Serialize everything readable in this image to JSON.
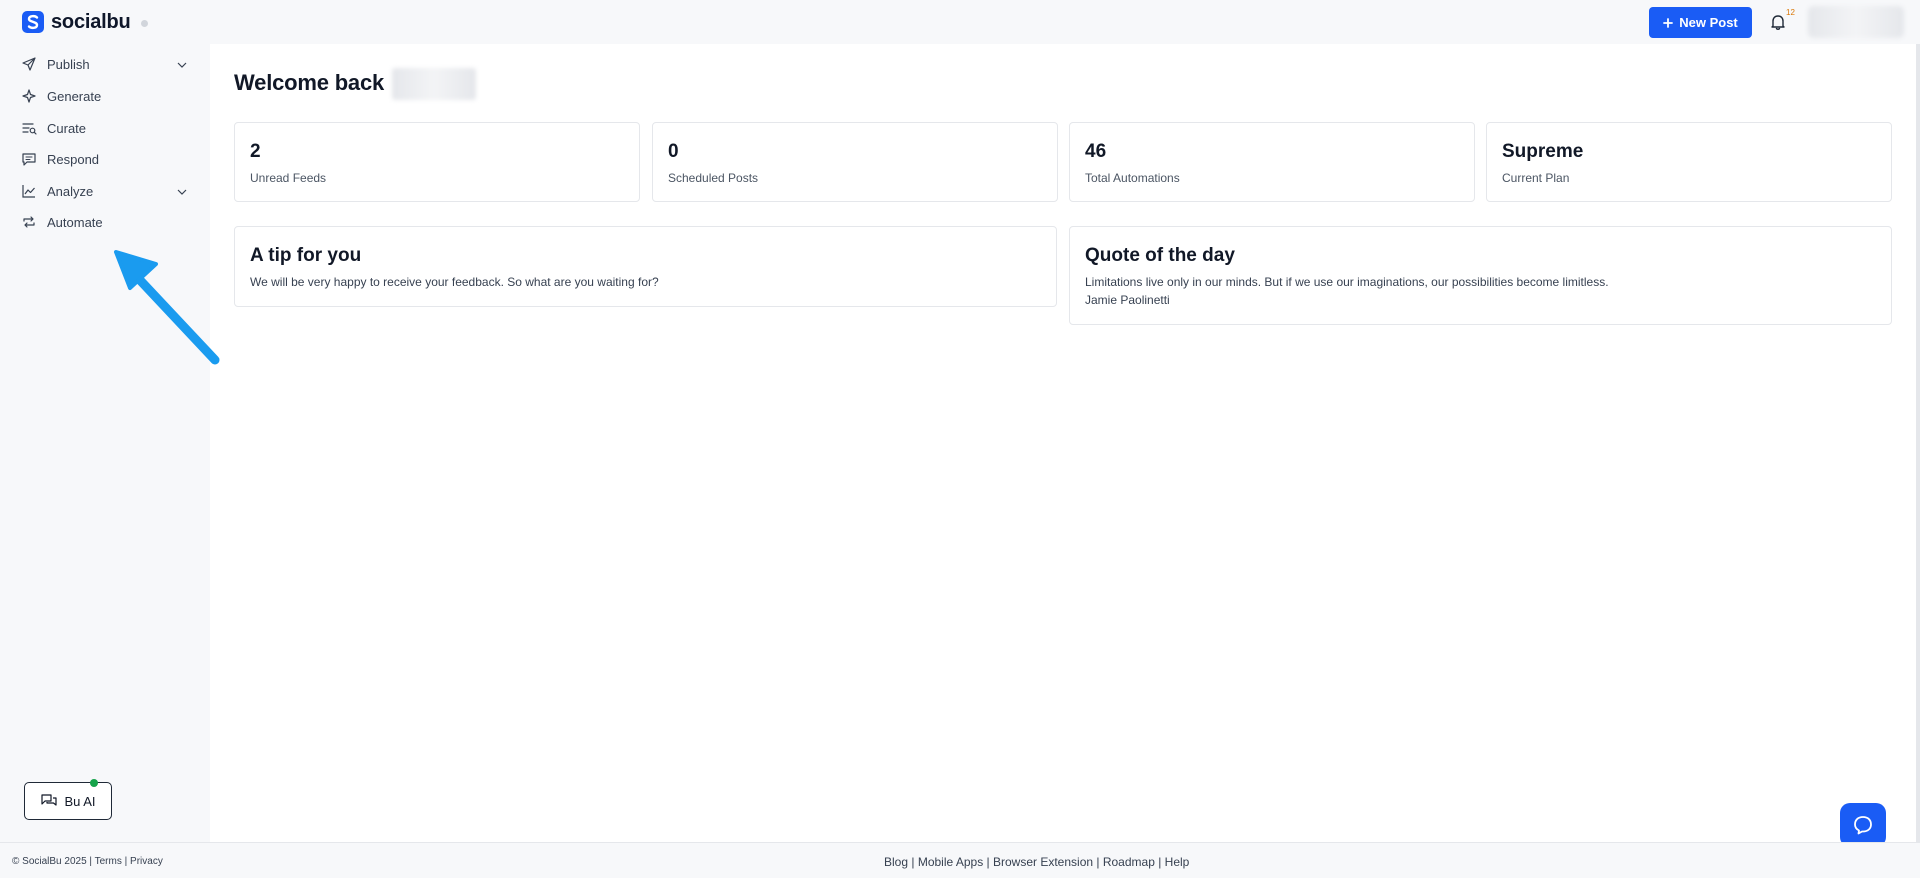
{
  "brand": {
    "name": "socialbu"
  },
  "header": {
    "new_post_label": "New Post",
    "notification_count": "12"
  },
  "sidebar": {
    "items": [
      {
        "label": "Publish",
        "icon": "send-icon",
        "has_children": true
      },
      {
        "label": "Generate",
        "icon": "sparkle-icon",
        "has_children": false
      },
      {
        "label": "Curate",
        "icon": "curate-icon",
        "has_children": false
      },
      {
        "label": "Respond",
        "icon": "message-icon",
        "has_children": false
      },
      {
        "label": "Analyze",
        "icon": "chart-line-icon",
        "has_children": true
      },
      {
        "label": "Automate",
        "icon": "repeat-icon",
        "has_children": false
      }
    ],
    "bu_ai_label": "Bu AI"
  },
  "main": {
    "welcome": "Welcome back",
    "stats": [
      {
        "value": "2",
        "label": "Unread Feeds"
      },
      {
        "value": "0",
        "label": "Scheduled Posts"
      },
      {
        "value": "46",
        "label": "Total Automations"
      },
      {
        "value": "Supreme",
        "label": "Current Plan"
      }
    ],
    "tip": {
      "title": "A tip for you",
      "text": "We will be very happy to receive your feedback. So what are you waiting for?"
    },
    "quote": {
      "title": "Quote of the day",
      "text": "Limitations live only in our minds. But if we use our imaginations, our possibilities become limitless.",
      "author": "Jamie Paolinetti"
    }
  },
  "footer": {
    "copyright": "© SocialBu 2025",
    "terms": "Terms",
    "privacy": "Privacy",
    "links": [
      "Blog",
      "Mobile Apps",
      "Browser Extension",
      "Roadmap",
      "Help"
    ]
  },
  "colors": {
    "accent": "#1a5cf5",
    "arrow": "#1a9bef",
    "online": "#16a34a"
  }
}
